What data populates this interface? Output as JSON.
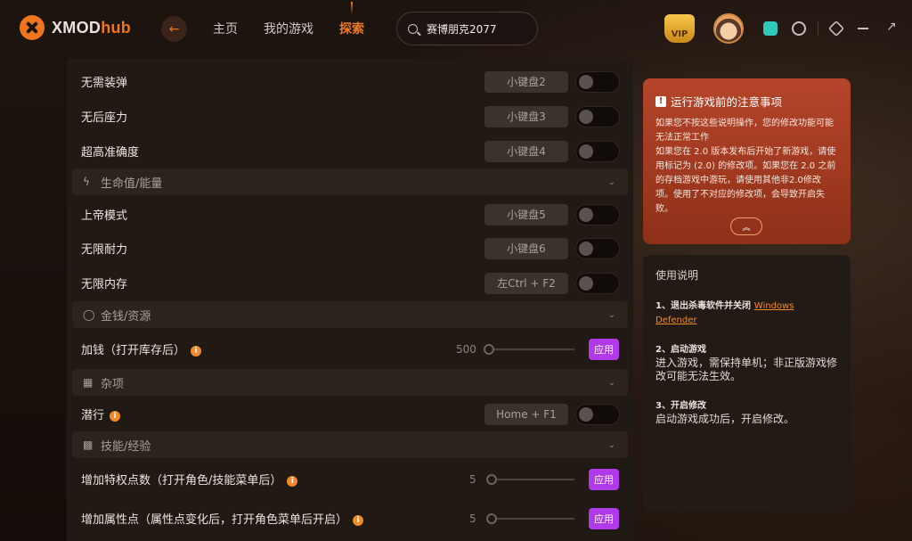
{
  "brand": {
    "name_main": "XMOD",
    "name_accent": "hub"
  },
  "nav": {
    "home": "主页",
    "my_games": "我的游戏",
    "explore": "探索"
  },
  "search": {
    "value": "赛博朋克2077"
  },
  "vip": {
    "label": "VIP"
  },
  "mods": {
    "rows1": [
      {
        "label": "无需装弹",
        "key": "小键盘2"
      },
      {
        "label": "无后座力",
        "key": "小键盘3"
      },
      {
        "label": "超高准确度",
        "key": "小键盘4"
      }
    ],
    "section_health": "生命值/能量",
    "rows2": [
      {
        "label": "上帝模式",
        "key": "小键盘5"
      },
      {
        "label": "无限耐力",
        "key": "小键盘6"
      },
      {
        "label": "无限内存",
        "key": "左Ctrl + F2"
      }
    ],
    "section_money": "金钱/资源",
    "money_row": {
      "label": "加钱（打开库存后）",
      "value": "500",
      "apply": "应用"
    },
    "section_misc": "杂项",
    "stealth_row": {
      "label": "潜行",
      "key": "Home + F1"
    },
    "section_skills": "技能/经验",
    "perk_row": {
      "label": "增加特权点数（打开角色/技能菜单后）",
      "value": "5",
      "apply": "应用"
    },
    "attr_row": {
      "label": "增加属性点（属性点变化后，打开角色菜单后开启）",
      "value": "5",
      "apply": "应用"
    }
  },
  "notice": {
    "title": "运行游戏前的注意事项",
    "body": "如果您不按这些说明操作，您的修改功能可能无法正常工作\n如果您在 2.0 版本发布后开始了新游戏，请使用标记为 (2.0) 的修改项。如果您在 2.0 之前的存档游戏中游玩，请使用其他非2.0修改项。使用了不对应的修改项，会导致开启失败。"
  },
  "guide": {
    "title": "使用说明",
    "step1_title": "1、退出杀毒软件并关闭",
    "step1_link": "Windows Defender",
    "step2_title": "2、启动游戏",
    "step2_desc": "进入游戏，需保持单机；非正版游戏修改可能无法生效。",
    "step3_title": "3、开启修改",
    "step3_desc": "启动游戏成功后，开启修改。"
  }
}
